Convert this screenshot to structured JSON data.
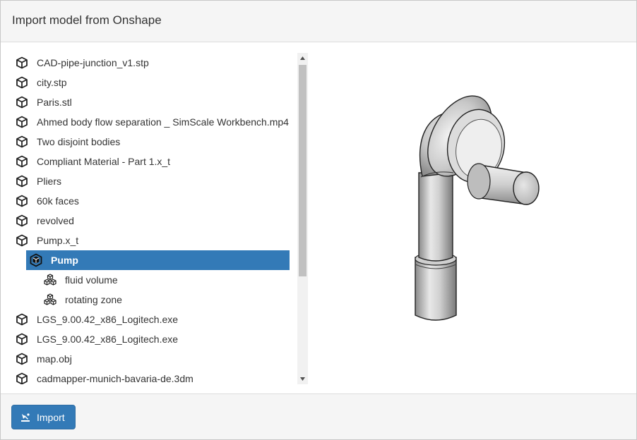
{
  "dialog": {
    "title": "Import model from Onshape"
  },
  "colors": {
    "accent": "#337ab7",
    "header_bg": "#f5f5f5",
    "text": "#333333"
  },
  "tree": {
    "items": [
      {
        "label": "CAD-pipe-junction_v1.stp",
        "icon": "cube-icon",
        "level": 0,
        "selected": false
      },
      {
        "label": "city.stp",
        "icon": "cube-icon",
        "level": 0,
        "selected": false
      },
      {
        "label": "Paris.stl",
        "icon": "cube-icon",
        "level": 0,
        "selected": false
      },
      {
        "label": "Ahmed body flow separation _ SimScale Workbench.mp4",
        "icon": "cube-icon",
        "level": 0,
        "selected": false
      },
      {
        "label": "Two disjoint bodies",
        "icon": "cube-icon",
        "level": 0,
        "selected": false
      },
      {
        "label": "Compliant Material - Part 1.x_t",
        "icon": "cube-icon",
        "level": 0,
        "selected": false
      },
      {
        "label": "Pliers",
        "icon": "cube-icon",
        "level": 0,
        "selected": false
      },
      {
        "label": "60k faces",
        "icon": "cube-icon",
        "level": 0,
        "selected": false
      },
      {
        "label": "revolved",
        "icon": "cube-icon",
        "level": 0,
        "selected": false
      },
      {
        "label": "Pump.x_t",
        "icon": "cube-icon",
        "level": 0,
        "selected": false
      },
      {
        "label": "Pump",
        "icon": "assembly-icon",
        "level": 1,
        "selected": true
      },
      {
        "label": "fluid volume",
        "icon": "parts-icon",
        "level": 2,
        "selected": false
      },
      {
        "label": "rotating zone",
        "icon": "parts-icon",
        "level": 2,
        "selected": false
      },
      {
        "label": "LGS_9.00.42_x86_Logitech.exe",
        "icon": "cube-icon",
        "level": 0,
        "selected": false
      },
      {
        "label": "LGS_9.00.42_x86_Logitech.exe",
        "icon": "cube-icon",
        "level": 0,
        "selected": false
      },
      {
        "label": "map.obj",
        "icon": "cube-icon",
        "level": 0,
        "selected": false
      },
      {
        "label": "cadmapper-munich-bavaria-de.3dm",
        "icon": "cube-icon",
        "level": 0,
        "selected": false
      }
    ]
  },
  "footer": {
    "import_label": "Import",
    "import_icon": "import-icon"
  }
}
